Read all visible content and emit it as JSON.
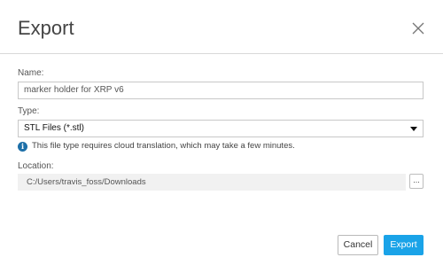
{
  "dialog": {
    "title": "Export",
    "close_icon": "close-icon"
  },
  "name": {
    "label": "Name:",
    "value": "marker holder for XRP v6"
  },
  "type": {
    "label": "Type:",
    "selected": "STL Files (*.stl)",
    "info_icon": "info-icon",
    "info_text": "This file type requires cloud translation, which may take a few minutes."
  },
  "location": {
    "label": "Location:",
    "value": "C:/Users/travis_foss/Downloads",
    "browse_label": "..."
  },
  "footer": {
    "cancel_label": "Cancel",
    "export_label": "Export"
  },
  "colors": {
    "accent": "#1aa3e8",
    "info": "#1c6fa8",
    "field_border": "#c8c8c8",
    "location_bg": "#f1f1f1"
  }
}
